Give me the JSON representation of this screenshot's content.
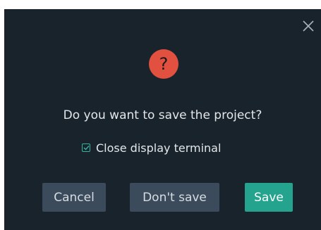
{
  "dialog": {
    "help_symbol": "?",
    "message": "Do you want to save the project?",
    "checkbox": {
      "label": "Close display terminal",
      "checked": true
    },
    "buttons": {
      "cancel": "Cancel",
      "dont_save": "Don't save",
      "save": "Save"
    },
    "icons": {
      "close": "close-icon",
      "help": "help-icon",
      "check": "checkmark-icon"
    }
  },
  "colors": {
    "background": "#19232c",
    "help_icon": "#e2503f",
    "accent": "#24a48f",
    "secondary_button": "#3b4b5b",
    "text": "#e3e7ea"
  }
}
